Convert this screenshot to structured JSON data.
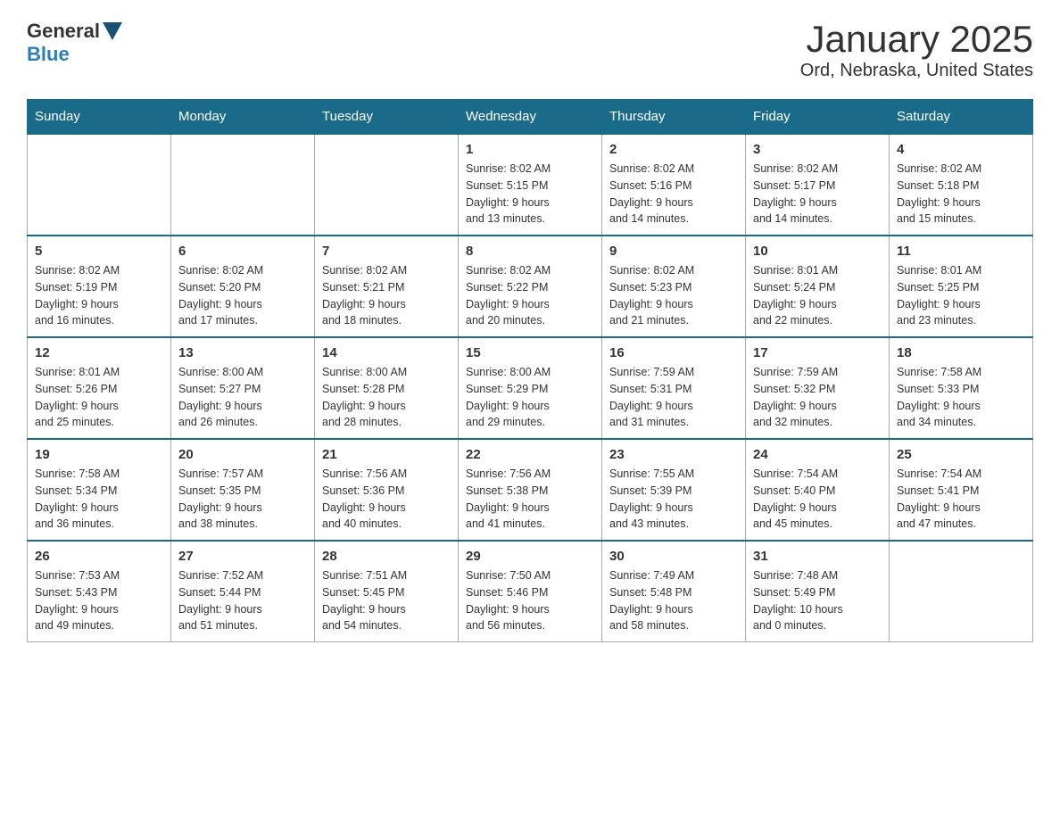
{
  "logo": {
    "general": "General",
    "blue": "Blue"
  },
  "title": "January 2025",
  "subtitle": "Ord, Nebraska, United States",
  "headers": [
    "Sunday",
    "Monday",
    "Tuesday",
    "Wednesday",
    "Thursday",
    "Friday",
    "Saturday"
  ],
  "weeks": [
    [
      {
        "day": "",
        "info": ""
      },
      {
        "day": "",
        "info": ""
      },
      {
        "day": "",
        "info": ""
      },
      {
        "day": "1",
        "info": "Sunrise: 8:02 AM\nSunset: 5:15 PM\nDaylight: 9 hours\nand 13 minutes."
      },
      {
        "day": "2",
        "info": "Sunrise: 8:02 AM\nSunset: 5:16 PM\nDaylight: 9 hours\nand 14 minutes."
      },
      {
        "day": "3",
        "info": "Sunrise: 8:02 AM\nSunset: 5:17 PM\nDaylight: 9 hours\nand 14 minutes."
      },
      {
        "day": "4",
        "info": "Sunrise: 8:02 AM\nSunset: 5:18 PM\nDaylight: 9 hours\nand 15 minutes."
      }
    ],
    [
      {
        "day": "5",
        "info": "Sunrise: 8:02 AM\nSunset: 5:19 PM\nDaylight: 9 hours\nand 16 minutes."
      },
      {
        "day": "6",
        "info": "Sunrise: 8:02 AM\nSunset: 5:20 PM\nDaylight: 9 hours\nand 17 minutes."
      },
      {
        "day": "7",
        "info": "Sunrise: 8:02 AM\nSunset: 5:21 PM\nDaylight: 9 hours\nand 18 minutes."
      },
      {
        "day": "8",
        "info": "Sunrise: 8:02 AM\nSunset: 5:22 PM\nDaylight: 9 hours\nand 20 minutes."
      },
      {
        "day": "9",
        "info": "Sunrise: 8:02 AM\nSunset: 5:23 PM\nDaylight: 9 hours\nand 21 minutes."
      },
      {
        "day": "10",
        "info": "Sunrise: 8:01 AM\nSunset: 5:24 PM\nDaylight: 9 hours\nand 22 minutes."
      },
      {
        "day": "11",
        "info": "Sunrise: 8:01 AM\nSunset: 5:25 PM\nDaylight: 9 hours\nand 23 minutes."
      }
    ],
    [
      {
        "day": "12",
        "info": "Sunrise: 8:01 AM\nSunset: 5:26 PM\nDaylight: 9 hours\nand 25 minutes."
      },
      {
        "day": "13",
        "info": "Sunrise: 8:00 AM\nSunset: 5:27 PM\nDaylight: 9 hours\nand 26 minutes."
      },
      {
        "day": "14",
        "info": "Sunrise: 8:00 AM\nSunset: 5:28 PM\nDaylight: 9 hours\nand 28 minutes."
      },
      {
        "day": "15",
        "info": "Sunrise: 8:00 AM\nSunset: 5:29 PM\nDaylight: 9 hours\nand 29 minutes."
      },
      {
        "day": "16",
        "info": "Sunrise: 7:59 AM\nSunset: 5:31 PM\nDaylight: 9 hours\nand 31 minutes."
      },
      {
        "day": "17",
        "info": "Sunrise: 7:59 AM\nSunset: 5:32 PM\nDaylight: 9 hours\nand 32 minutes."
      },
      {
        "day": "18",
        "info": "Sunrise: 7:58 AM\nSunset: 5:33 PM\nDaylight: 9 hours\nand 34 minutes."
      }
    ],
    [
      {
        "day": "19",
        "info": "Sunrise: 7:58 AM\nSunset: 5:34 PM\nDaylight: 9 hours\nand 36 minutes."
      },
      {
        "day": "20",
        "info": "Sunrise: 7:57 AM\nSunset: 5:35 PM\nDaylight: 9 hours\nand 38 minutes."
      },
      {
        "day": "21",
        "info": "Sunrise: 7:56 AM\nSunset: 5:36 PM\nDaylight: 9 hours\nand 40 minutes."
      },
      {
        "day": "22",
        "info": "Sunrise: 7:56 AM\nSunset: 5:38 PM\nDaylight: 9 hours\nand 41 minutes."
      },
      {
        "day": "23",
        "info": "Sunrise: 7:55 AM\nSunset: 5:39 PM\nDaylight: 9 hours\nand 43 minutes."
      },
      {
        "day": "24",
        "info": "Sunrise: 7:54 AM\nSunset: 5:40 PM\nDaylight: 9 hours\nand 45 minutes."
      },
      {
        "day": "25",
        "info": "Sunrise: 7:54 AM\nSunset: 5:41 PM\nDaylight: 9 hours\nand 47 minutes."
      }
    ],
    [
      {
        "day": "26",
        "info": "Sunrise: 7:53 AM\nSunset: 5:43 PM\nDaylight: 9 hours\nand 49 minutes."
      },
      {
        "day": "27",
        "info": "Sunrise: 7:52 AM\nSunset: 5:44 PM\nDaylight: 9 hours\nand 51 minutes."
      },
      {
        "day": "28",
        "info": "Sunrise: 7:51 AM\nSunset: 5:45 PM\nDaylight: 9 hours\nand 54 minutes."
      },
      {
        "day": "29",
        "info": "Sunrise: 7:50 AM\nSunset: 5:46 PM\nDaylight: 9 hours\nand 56 minutes."
      },
      {
        "day": "30",
        "info": "Sunrise: 7:49 AM\nSunset: 5:48 PM\nDaylight: 9 hours\nand 58 minutes."
      },
      {
        "day": "31",
        "info": "Sunrise: 7:48 AM\nSunset: 5:49 PM\nDaylight: 10 hours\nand 0 minutes."
      },
      {
        "day": "",
        "info": ""
      }
    ]
  ]
}
